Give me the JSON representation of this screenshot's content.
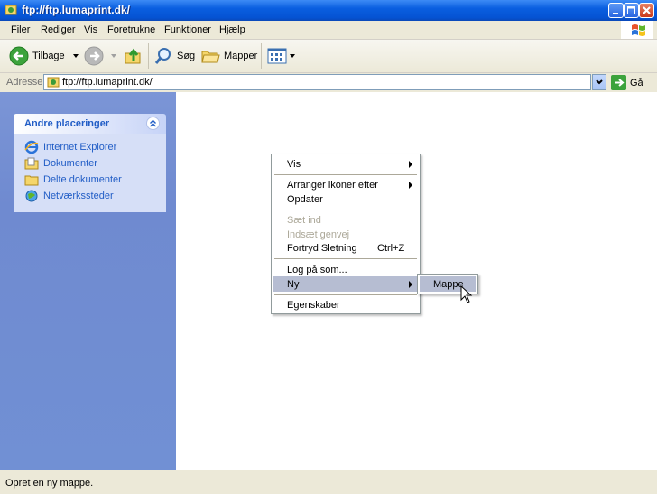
{
  "window": {
    "title": "ftp://ftp.lumaprint.dk/"
  },
  "menubar": {
    "items": [
      "Filer",
      "Rediger",
      "Vis",
      "Foretrukne",
      "Funktioner",
      "Hjælp"
    ]
  },
  "toolbar": {
    "back_label": "Tilbage",
    "search_label": "Søg",
    "folders_label": "Mapper"
  },
  "address": {
    "label": "Adresse",
    "value": "ftp://ftp.lumaprint.dk/",
    "go_label": "Gå"
  },
  "sidebar": {
    "title": "Andre placeringer",
    "items": [
      {
        "label": "Internet Explorer",
        "icon": "internet-explorer-icon"
      },
      {
        "label": "Dokumenter",
        "icon": "documents-folder-icon"
      },
      {
        "label": "Delte dokumenter",
        "icon": "shared-documents-folder-icon"
      },
      {
        "label": "Netværkssteder",
        "icon": "network-places-icon"
      }
    ]
  },
  "context_menu": {
    "view": "Vis",
    "arrange": "Arranger ikoner efter",
    "refresh": "Opdater",
    "paste": "Sæt ind",
    "paste_shortcut": "Indsæt genvej",
    "undo_delete": "Fortryd Sletning",
    "undo_delete_shortcut": "Ctrl+Z",
    "login_as": "Log på som...",
    "new": "Ny",
    "properties": "Egenskaber"
  },
  "submenu": {
    "folder": "Mappe"
  },
  "statusbar": {
    "text": "Opret en ny mappe."
  },
  "colors": {
    "titlebar": "#0553d3",
    "sidebar": "#7190d4",
    "highlight": "#b6bdd2",
    "link": "#215dc6"
  }
}
